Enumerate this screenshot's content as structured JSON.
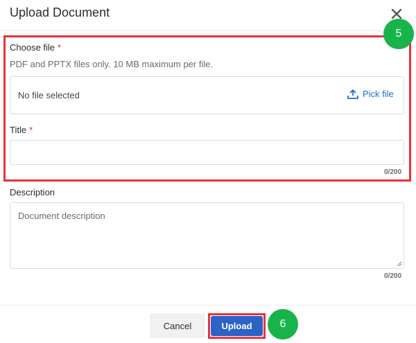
{
  "dialog": {
    "title": "Upload Document",
    "close_icon": "close-icon"
  },
  "form": {
    "choose_file": {
      "label": "Choose file",
      "required_marker": "*",
      "helper": "PDF and PPTX files only. 10 MB maximum per file.",
      "status": "No file selected",
      "pick_label": "Pick file",
      "pick_icon": "upload-icon"
    },
    "title": {
      "label": "Title",
      "required_marker": "*",
      "value": "",
      "counter": "0/200"
    },
    "description": {
      "label": "Description",
      "placeholder": "Document description",
      "counter": "0/200"
    }
  },
  "footer": {
    "cancel_label": "Cancel",
    "upload_label": "Upload"
  },
  "annotations": {
    "badge_5": "5",
    "badge_6": "6",
    "highlight_color": "#e8323c",
    "badge_color": "#18b44b"
  },
  "colors": {
    "primary": "#2b63c7",
    "link": "#1f6fd1",
    "required": "#d32f2f"
  }
}
